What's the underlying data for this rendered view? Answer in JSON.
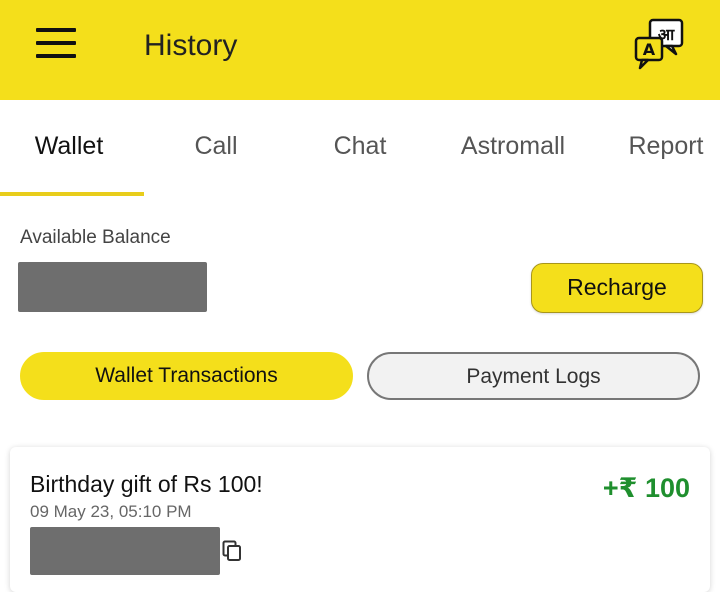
{
  "header": {
    "title": "History",
    "menu_icon": "hamburger-menu-icon",
    "translate_icon": "language-translate-icon",
    "translate_glyph_hi": "आ",
    "translate_glyph_en": "A",
    "background_color": "#F4DF1B"
  },
  "tabs": [
    {
      "label": "Wallet",
      "active": true
    },
    {
      "label": "Call",
      "active": false
    },
    {
      "label": "Chat",
      "active": false
    },
    {
      "label": "Astromall",
      "active": false
    },
    {
      "label": "Report",
      "active": false
    }
  ],
  "wallet": {
    "balance_label": "Available Balance",
    "recharge_label": "Recharge"
  },
  "segments": {
    "transactions_label": "Wallet Transactions",
    "payment_logs_label": "Payment Logs"
  },
  "transactions": [
    {
      "title": "Birthday gift of Rs 100!",
      "timestamp": "09 May 23, 05:10 PM",
      "amount": "+₹ 100",
      "amount_color": "#1f8f2e",
      "copy_icon": "copy-icon"
    }
  ]
}
